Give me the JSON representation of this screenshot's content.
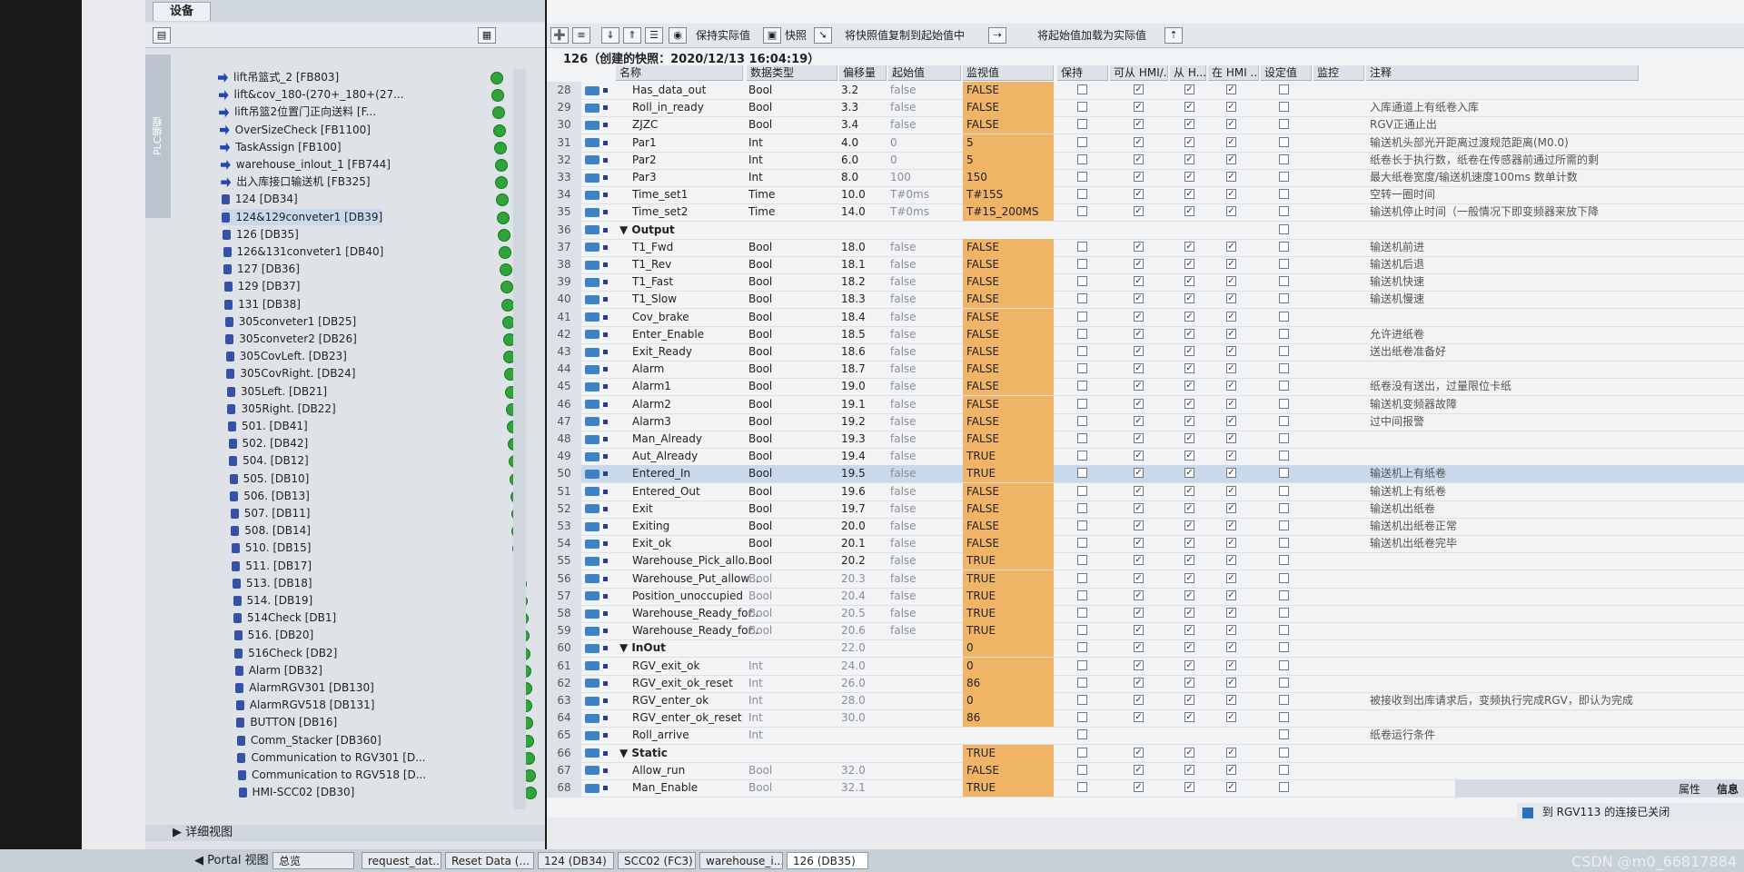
{
  "left_tab": "设备",
  "plc_tab": "PLC编程",
  "details_view": "详细视图",
  "portal_view": "Portal 视图",
  "tree": [
    {
      "type": "fb",
      "label": "lift吊篮式_2 [FB803]"
    },
    {
      "type": "fb",
      "label": "lift&cov_180-(270+_180+(27..."
    },
    {
      "type": "fb",
      "label": "lift吊篮2位置门正向送料 [F..."
    },
    {
      "type": "fb",
      "label": "OverSizeCheck [FB1100]"
    },
    {
      "type": "fb",
      "label": "TaskAssign [FB100]"
    },
    {
      "type": "fb",
      "label": "warehouse_inlout_1 [FB744]"
    },
    {
      "type": "fb",
      "label": "出入库接口输送机 [FB325]"
    },
    {
      "type": "db",
      "label": "124 [DB34]"
    },
    {
      "type": "db",
      "label": "124&129conveter1 [DB39]"
    },
    {
      "type": "db",
      "label": "126 [DB35]"
    },
    {
      "type": "db",
      "label": "126&131conveter1 [DB40]"
    },
    {
      "type": "db",
      "label": "127 [DB36]"
    },
    {
      "type": "db",
      "label": "129 [DB37]"
    },
    {
      "type": "db",
      "label": "131 [DB38]"
    },
    {
      "type": "db",
      "label": "305conveter1 [DB25]"
    },
    {
      "type": "db",
      "label": "305conveter2 [DB26]"
    },
    {
      "type": "db",
      "label": "305CovLeft. [DB23]"
    },
    {
      "type": "db",
      "label": "305CovRight. [DB24]"
    },
    {
      "type": "db",
      "label": "305Left. [DB21]"
    },
    {
      "type": "db",
      "label": "305Right. [DB22]"
    },
    {
      "type": "db",
      "label": "501. [DB41]"
    },
    {
      "type": "db",
      "label": "502. [DB42]"
    },
    {
      "type": "db",
      "label": "504. [DB12]"
    },
    {
      "type": "db",
      "label": "505. [DB10]"
    },
    {
      "type": "db",
      "label": "506. [DB13]"
    },
    {
      "type": "db",
      "label": "507. [DB11]"
    },
    {
      "type": "db",
      "label": "508. [DB14]"
    },
    {
      "type": "db",
      "label": "510. [DB15]"
    },
    {
      "type": "db",
      "label": "511. [DB17]"
    },
    {
      "type": "db",
      "label": "513. [DB18]"
    },
    {
      "type": "db",
      "label": "514. [DB19]"
    },
    {
      "type": "db",
      "label": "514Check [DB1]"
    },
    {
      "type": "db",
      "label": "516. [DB20]"
    },
    {
      "type": "db",
      "label": "516Check [DB2]"
    },
    {
      "type": "db",
      "label": "Alarm [DB32]"
    },
    {
      "type": "db",
      "label": "AlarmRGV301 [DB130]"
    },
    {
      "type": "db",
      "label": "AlarmRGV518 [DB131]"
    },
    {
      "type": "db",
      "label": "BUTTON [DB16]"
    },
    {
      "type": "db",
      "label": "Comm_Stacker [DB360]"
    },
    {
      "type": "db",
      "label": "Communication to RGV301 [D..."
    },
    {
      "type": "db",
      "label": "Communication to RGV518 [D..."
    },
    {
      "type": "db",
      "label": "HMI-SCC02 [DB30]"
    }
  ],
  "toolbar": {
    "keep_actual": "保持实际值",
    "snapshot": "快照",
    "copy_snapshot": "将快照值复制到起始值中",
    "load_start": "将起始值加载为实际值"
  },
  "snapshot_title": "126（创建的快照：2020/12/13 16:04:19）",
  "columns": [
    "名称",
    "数据类型",
    "偏移量",
    "起始值",
    "监视值",
    "保持",
    "可从 HMI/...",
    "从 H...",
    "在 HMI ...",
    "设定值",
    "监控",
    "注释"
  ],
  "rows": [
    {
      "n": "28",
      "name": "Has_data_out",
      "type": "Bool",
      "off": "3.2",
      "start": "false",
      "mon": "FALSE",
      "p": "",
      "h1": "✓",
      "h2": "✓",
      "h3": "✓",
      "c": ""
    },
    {
      "n": "29",
      "name": "Roll_in_ready",
      "type": "Bool",
      "off": "3.3",
      "start": "false",
      "mon": "FALSE",
      "p": "",
      "h1": "✓",
      "h2": "✓",
      "h3": "✓",
      "c": "入库通道上有纸卷入库"
    },
    {
      "n": "30",
      "name": "ZJZC",
      "type": "Bool",
      "off": "3.4",
      "start": "false",
      "mon": "FALSE",
      "p": "",
      "h1": "✓",
      "h2": "✓",
      "h3": "✓",
      "c": "RGV正通止出"
    },
    {
      "n": "31",
      "name": "Par1",
      "type": "Int",
      "off": "4.0",
      "start": "0",
      "mon": "5",
      "p": "",
      "h1": "✓",
      "h2": "✓",
      "h3": "✓",
      "c": "输送机头部光开距离过渡规范距离(M0.0)"
    },
    {
      "n": "32",
      "name": "Par2",
      "type": "Int",
      "off": "6.0",
      "start": "0",
      "mon": "5",
      "p": "",
      "h1": "✓",
      "h2": "✓",
      "h3": "✓",
      "c": "纸卷长于执行数，纸卷在传感器前通过所需的剩"
    },
    {
      "n": "33",
      "name": "Par3",
      "type": "Int",
      "off": "8.0",
      "start": "100",
      "mon": "150",
      "p": "",
      "h1": "✓",
      "h2": "✓",
      "h3": "✓",
      "c": "最大纸卷宽度/输送机速度100ms 数单计数"
    },
    {
      "n": "34",
      "name": "Time_set1",
      "type": "Time",
      "off": "10.0",
      "start": "T#0ms",
      "mon": "T#15S",
      "p": "",
      "h1": "✓",
      "h2": "✓",
      "h3": "✓",
      "c": "空转一圈时间"
    },
    {
      "n": "35",
      "name": "Time_set2",
      "type": "Time",
      "off": "14.0",
      "start": "T#0ms",
      "mon": "T#1S_200MS",
      "p": "",
      "h1": "✓",
      "h2": "✓",
      "h3": "✓",
      "c": "输送机停止时间（一般情况下即变频器来放下降"
    },
    {
      "n": "36",
      "name": "▼ Output",
      "type": "",
      "off": "",
      "start": "",
      "mon": "",
      "p": "",
      "h1": "",
      "h2": "",
      "h3": "",
      "c": "",
      "group": true
    },
    {
      "n": "37",
      "name": "T1_Fwd",
      "type": "Bool",
      "off": "18.0",
      "start": "false",
      "mon": "FALSE",
      "p": "",
      "h1": "✓",
      "h2": "✓",
      "h3": "✓",
      "c": "输送机前进"
    },
    {
      "n": "38",
      "name": "T1_Rev",
      "type": "Bool",
      "off": "18.1",
      "start": "false",
      "mon": "FALSE",
      "p": "",
      "h1": "✓",
      "h2": "✓",
      "h3": "✓",
      "c": "输送机后退"
    },
    {
      "n": "39",
      "name": "T1_Fast",
      "type": "Bool",
      "off": "18.2",
      "start": "false",
      "mon": "FALSE",
      "p": "",
      "h1": "✓",
      "h2": "✓",
      "h3": "✓",
      "c": "输送机快速"
    },
    {
      "n": "40",
      "name": "T1_Slow",
      "type": "Bool",
      "off": "18.3",
      "start": "false",
      "mon": "FALSE",
      "p": "",
      "h1": "✓",
      "h2": "✓",
      "h3": "✓",
      "c": "输送机慢速"
    },
    {
      "n": "41",
      "name": "Cov_brake",
      "type": "Bool",
      "off": "18.4",
      "start": "false",
      "mon": "FALSE",
      "p": "",
      "h1": "✓",
      "h2": "✓",
      "h3": "✓",
      "c": ""
    },
    {
      "n": "42",
      "name": "Enter_Enable",
      "type": "Bool",
      "off": "18.5",
      "start": "false",
      "mon": "FALSE",
      "p": "",
      "h1": "✓",
      "h2": "✓",
      "h3": "✓",
      "c": "允许进纸卷"
    },
    {
      "n": "43",
      "name": "Exit_Ready",
      "type": "Bool",
      "off": "18.6",
      "start": "false",
      "mon": "FALSE",
      "p": "",
      "h1": "✓",
      "h2": "✓",
      "h3": "✓",
      "c": "送出纸卷准备好"
    },
    {
      "n": "44",
      "name": "Alarm",
      "type": "Bool",
      "off": "18.7",
      "start": "false",
      "mon": "FALSE",
      "p": "",
      "h1": "✓",
      "h2": "✓",
      "h3": "✓",
      "c": ""
    },
    {
      "n": "45",
      "name": "Alarm1",
      "type": "Bool",
      "off": "19.0",
      "start": "false",
      "mon": "FALSE",
      "p": "",
      "h1": "✓",
      "h2": "✓",
      "h3": "✓",
      "c": "纸卷没有送出，过量限位卡纸"
    },
    {
      "n": "46",
      "name": "Alarm2",
      "type": "Bool",
      "off": "19.1",
      "start": "false",
      "mon": "FALSE",
      "p": "",
      "h1": "✓",
      "h2": "✓",
      "h3": "✓",
      "c": "输送机变频器故障"
    },
    {
      "n": "47",
      "name": "Alarm3",
      "type": "Bool",
      "off": "19.2",
      "start": "false",
      "mon": "FALSE",
      "p": "",
      "h1": "✓",
      "h2": "✓",
      "h3": "✓",
      "c": "过中间报警"
    },
    {
      "n": "48",
      "name": "Man_Already",
      "type": "Bool",
      "off": "19.3",
      "start": "false",
      "mon": "FALSE",
      "p": "",
      "h1": "✓",
      "h2": "✓",
      "h3": "✓",
      "c": ""
    },
    {
      "n": "49",
      "name": "Aut_Already",
      "type": "Bool",
      "off": "19.4",
      "start": "false",
      "mon": "TRUE",
      "p": "",
      "h1": "✓",
      "h2": "✓",
      "h3": "✓",
      "c": ""
    },
    {
      "n": "50",
      "name": "Entered_In",
      "type": "Bool",
      "off": "19.5",
      "start": "false",
      "mon": "TRUE",
      "p": "",
      "h1": "✓",
      "h2": "✓",
      "h3": "✓",
      "c": "输送机上有纸卷",
      "sel": true
    },
    {
      "n": "51",
      "name": "Entered_Out",
      "type": "Bool",
      "off": "19.6",
      "start": "false",
      "mon": "FALSE",
      "p": "",
      "h1": "✓",
      "h2": "✓",
      "h3": "✓",
      "c": "输送机上有纸卷"
    },
    {
      "n": "52",
      "name": "Exit",
      "type": "Bool",
      "off": "19.7",
      "start": "false",
      "mon": "FALSE",
      "p": "",
      "h1": "✓",
      "h2": "✓",
      "h3": "✓",
      "c": "输送机出纸卷"
    },
    {
      "n": "53",
      "name": "Exiting",
      "type": "Bool",
      "off": "20.0",
      "start": "false",
      "mon": "FALSE",
      "p": "",
      "h1": "✓",
      "h2": "✓",
      "h3": "✓",
      "c": "输送机出纸卷正常"
    },
    {
      "n": "54",
      "name": "Exit_ok",
      "type": "Bool",
      "off": "20.1",
      "start": "false",
      "mon": "FALSE",
      "p": "",
      "h1": "✓",
      "h2": "✓",
      "h3": "✓",
      "c": "输送机出纸卷完毕"
    },
    {
      "n": "55",
      "name": "Warehouse_Pick_allo...",
      "type": "Bool",
      "off": "20.2",
      "start": "false",
      "mon": "TRUE",
      "p": "",
      "h1": "✓",
      "h2": "✓",
      "h3": "✓",
      "c": ""
    },
    {
      "n": "56",
      "name": "Warehouse_Put_allow...",
      "type": "Bool",
      "off": "20.3",
      "start": "false",
      "mon": "TRUE",
      "p": "",
      "h1": "✓",
      "h2": "✓",
      "h3": "✓",
      "c": ""
    },
    {
      "n": "57",
      "name": "Position_unoccupied",
      "type": "Bool",
      "off": "20.4",
      "start": "false",
      "mon": "TRUE",
      "p": "",
      "h1": "✓",
      "h2": "✓",
      "h3": "✓",
      "c": ""
    },
    {
      "n": "58",
      "name": "Warehouse_Ready_for...",
      "type": "Bool",
      "off": "20.5",
      "start": "false",
      "mon": "TRUE",
      "p": "",
      "h1": "✓",
      "h2": "✓",
      "h3": "✓",
      "c": ""
    },
    {
      "n": "59",
      "name": "Warehouse_Ready_for...",
      "type": "Bool",
      "off": "20.6",
      "start": "false",
      "mon": "TRUE",
      "p": "",
      "h1": "✓",
      "h2": "✓",
      "h3": "✓",
      "c": ""
    },
    {
      "n": "60",
      "name": "▼ InOut",
      "type": "",
      "off": "22.0",
      "start": "",
      "mon": "0",
      "p": "",
      "h1": "✓",
      "h2": "✓",
      "h3": "✓",
      "c": "",
      "group": true
    },
    {
      "n": "61",
      "name": "RGV_exit_ok",
      "type": "Int",
      "off": "24.0",
      "start": "",
      "mon": "0",
      "p": "",
      "h1": "✓",
      "h2": "✓",
      "h3": "✓",
      "c": ""
    },
    {
      "n": "62",
      "name": "RGV_exit_ok_reset",
      "type": "Int",
      "off": "26.0",
      "start": "",
      "mon": "86",
      "p": "",
      "h1": "✓",
      "h2": "✓",
      "h3": "✓",
      "c": ""
    },
    {
      "n": "63",
      "name": "RGV_enter_ok",
      "type": "Int",
      "off": "28.0",
      "start": "",
      "mon": "0",
      "p": "",
      "h1": "✓",
      "h2": "✓",
      "h3": "✓",
      "c": "被接收到出库请求后，变频执行完成RGV，即认为完成"
    },
    {
      "n": "64",
      "name": "RGV_enter_ok_reset",
      "type": "Int",
      "off": "30.0",
      "start": "",
      "mon": "86",
      "p": "",
      "h1": "✓",
      "h2": "✓",
      "h3": "✓",
      "c": ""
    },
    {
      "n": "65",
      "name": "Roll_arrive",
      "type": "Int",
      "off": "",
      "start": "",
      "mon": "",
      "p": "",
      "h1": "",
      "h2": "",
      "h3": "",
      "c": "纸卷运行条件"
    },
    {
      "n": "66",
      "name": "▼ Static",
      "type": "",
      "off": "",
      "start": "",
      "mon": "TRUE",
      "p": "",
      "h1": "✓",
      "h2": "✓",
      "h3": "✓",
      "c": "",
      "group": true
    },
    {
      "n": "67",
      "name": "Allow_run",
      "type": "Bool",
      "off": "32.0",
      "start": "",
      "mon": "FALSE",
      "p": "",
      "h1": "✓",
      "h2": "✓",
      "h3": "✓",
      "c": ""
    },
    {
      "n": "68",
      "name": "Man_Enable",
      "type": "Bool",
      "off": "32.1",
      "start": "",
      "mon": "TRUE",
      "p": "",
      "h1": "✓",
      "h2": "✓",
      "h3": "✓",
      "c": ""
    }
  ],
  "right_tabs": {
    "props": "属性",
    "info": "信息"
  },
  "status_text": "到 RGV113 的连接已关闭",
  "taskbar": [
    "总览",
    "request_dat...",
    "Reset Data (...",
    "124 (DB34)",
    "SCC02 (FC3)",
    "warehouse_i...",
    "126 (DB35)"
  ],
  "watermark": "CSDN @m0_66817884"
}
